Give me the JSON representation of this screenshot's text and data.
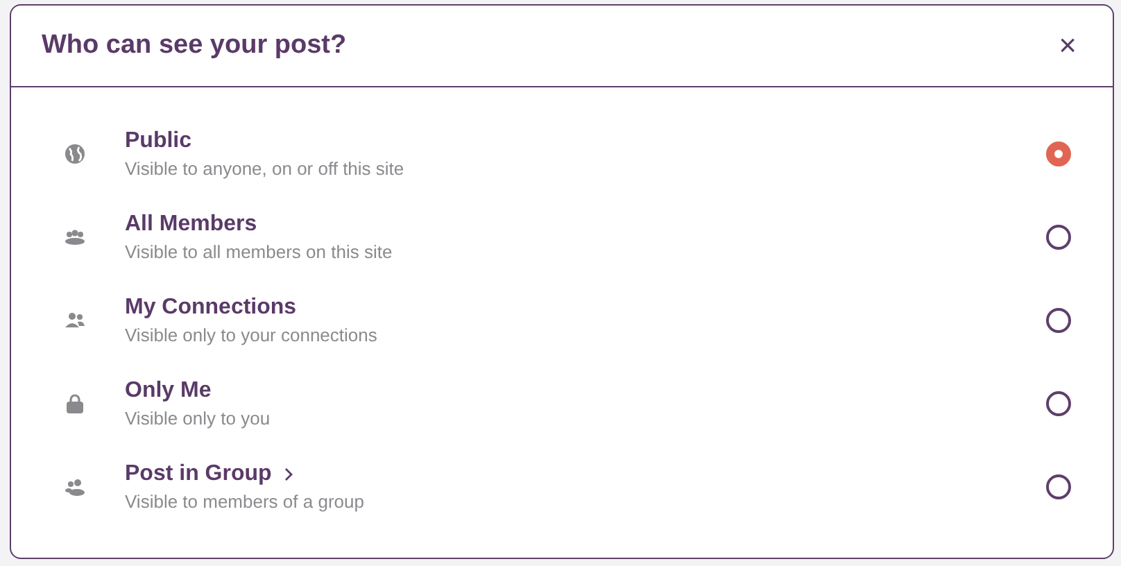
{
  "dialog": {
    "title": "Who can see your post?",
    "close": "×"
  },
  "options": [
    {
      "kind": "globe",
      "label": "Public",
      "description": "Visible to anyone, on or off this site",
      "selected": true,
      "submenu": false
    },
    {
      "kind": "members",
      "label": "All Members",
      "description": "Visible to all members on this site",
      "selected": false,
      "submenu": false
    },
    {
      "kind": "connections",
      "label": "My Connections",
      "description": "Visible only to your connections",
      "selected": false,
      "submenu": false
    },
    {
      "kind": "lock",
      "label": "Only Me",
      "description": "Visible only to you",
      "selected": false,
      "submenu": false
    },
    {
      "kind": "group",
      "label": "Post in Group",
      "description": "Visible to members of a group",
      "selected": false,
      "submenu": true
    }
  ]
}
